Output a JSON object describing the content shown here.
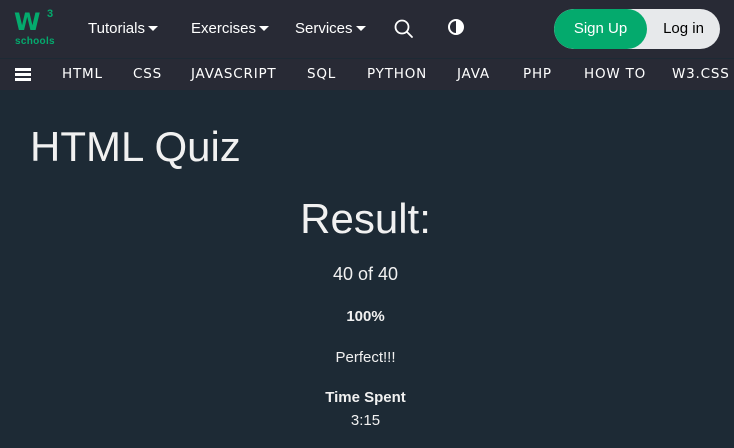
{
  "header": {
    "logo": {
      "mark": "W",
      "sup": "3",
      "subtitle": "schools"
    },
    "nav": {
      "tutorials": "Tutorials",
      "exercises": "Exercises",
      "services": "Services"
    },
    "icons": {
      "search": "search-icon",
      "theme": "contrast-icon"
    },
    "signup_label": "Sign Up",
    "login_label": "Log in",
    "colors": {
      "brand": "#04aa6d",
      "bar": "#282a35"
    }
  },
  "subnav": {
    "menu_icon": "menu-icon",
    "items": [
      "HTML",
      "CSS",
      "JAVASCRIPT",
      "SQL",
      "PYTHON",
      "JAVA",
      "PHP",
      "HOW TO",
      "W3.CSS"
    ]
  },
  "main": {
    "title": "HTML Quiz",
    "result_heading": "Result:",
    "score": "40 of 40",
    "percent": "100%",
    "verdict": "Perfect!!!",
    "time_label": "Time Spent",
    "time_value": "3:15",
    "colors": {
      "background": "#1d2a35",
      "text": "#f1f1f1"
    }
  }
}
